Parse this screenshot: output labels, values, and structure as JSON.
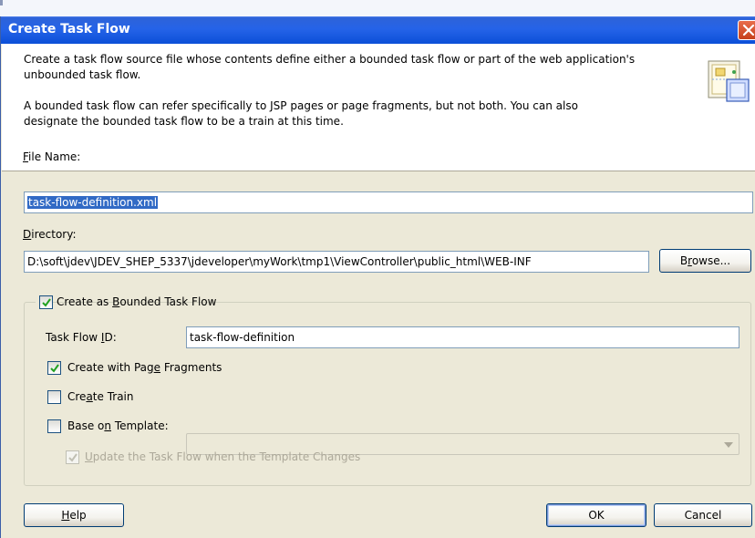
{
  "dialog": {
    "title": "Create Task Flow"
  },
  "header": {
    "line1": "Create a task flow source file whose contents define either a bounded task flow or part of the web application's",
    "line2": "unbounded task flow.",
    "line3": "A bounded task flow can refer specifically to JSP pages or page fragments, but not both.  You can also",
    "line4": "designate the bounded task flow to be a train at this time."
  },
  "file_name": {
    "label_prefix": "",
    "label_mnemonic": "F",
    "label_rest": "ile Name:",
    "value": "task-flow-definition.xml"
  },
  "directory": {
    "label_prefix": "",
    "label_mnemonic": "D",
    "label_rest": "irectory:",
    "value": "D:\\soft\\jdev\\JDEV_SHEP_5337\\jdeveloper\\myWork\\tmp1\\ViewController\\public_html\\WEB-INF"
  },
  "browse_button": {
    "prefix": "B",
    "mnemonic": "r",
    "rest": "owse..."
  },
  "bounded": {
    "label_prefix": "Create as ",
    "label_mnemonic": "B",
    "label_rest": "ounded Task Flow",
    "checked": true
  },
  "task_flow_id": {
    "label_prefix": "Task Flow ",
    "label_mnemonic": "I",
    "label_rest": "D:",
    "value": "task-flow-definition"
  },
  "page_fragments": {
    "label_prefix": "Create with Pag",
    "label_mnemonic": "e",
    "label_rest": " Fragments",
    "checked": true
  },
  "create_train": {
    "label_prefix": "Cre",
    "label_mnemonic": "a",
    "label_rest": "te Train",
    "checked": false
  },
  "base_on_template": {
    "label_prefix": "Base o",
    "label_mnemonic": "n",
    "label_rest": " Template:",
    "checked": false,
    "selected": ""
  },
  "update_on_template_change": {
    "label_prefix": "",
    "label_mnemonic": "U",
    "label_rest": "pdate the Task Flow when the Template Changes",
    "checked": true,
    "enabled": false
  },
  "buttons": {
    "help": {
      "prefix": "",
      "mnemonic": "H",
      "rest": "elp"
    },
    "ok": "OK",
    "cancel": "Cancel"
  },
  "colors": {
    "title_bar": "#2563e8",
    "dialog_bg": "#ece9d8",
    "selection": "#316ac5",
    "check": "#21a121"
  },
  "icons": [
    "close-icon",
    "task-flow-wizard-icon",
    "checkmark-icon",
    "dropdown-arrow-icon"
  ]
}
